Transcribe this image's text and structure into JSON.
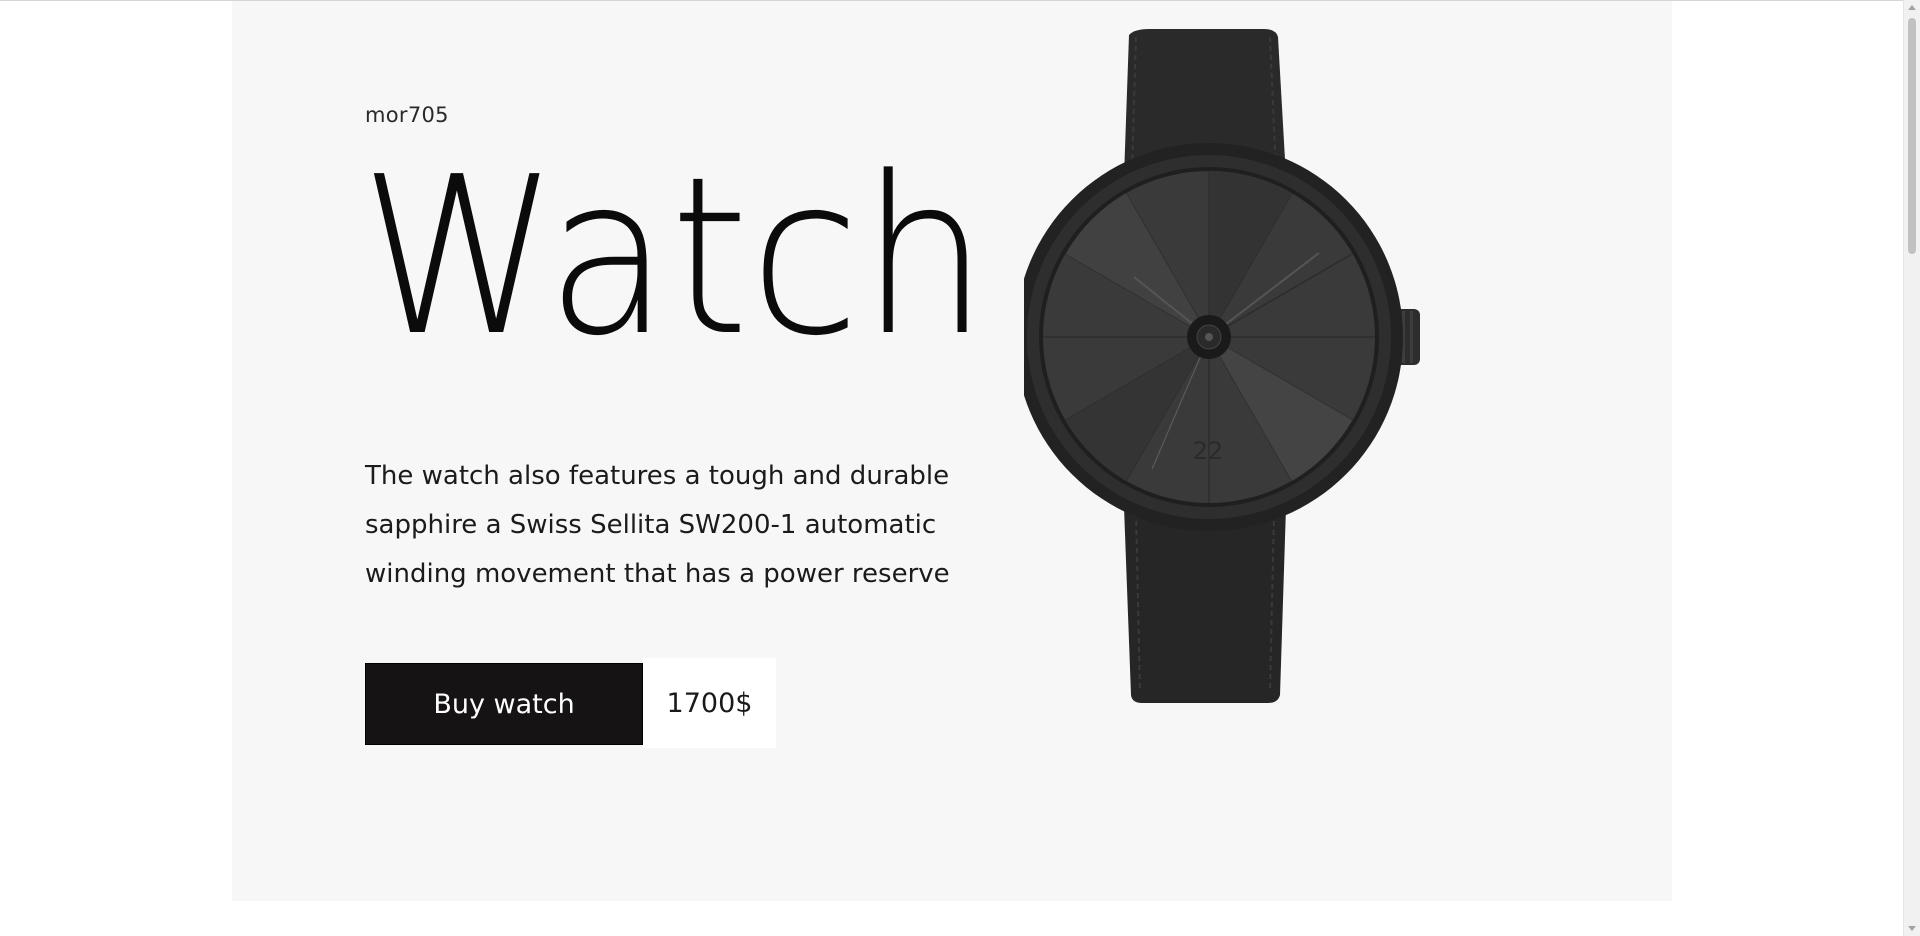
{
  "hero": {
    "brand": "mor705",
    "title": "Watch",
    "description": "The watch also features a tough and durable sapphire a Swiss Sellita SW200-1 automatic winding movement that has a power reserve",
    "buy_label": "Buy watch",
    "price": "1700$",
    "dial_number": "22"
  },
  "colors": {
    "background": "#ffffff",
    "card": "#f7f7f7",
    "button": "#151313",
    "button_text": "#ffffff",
    "watch": "#2b2b2b"
  },
  "icons": {
    "product_image": "watch-image"
  }
}
